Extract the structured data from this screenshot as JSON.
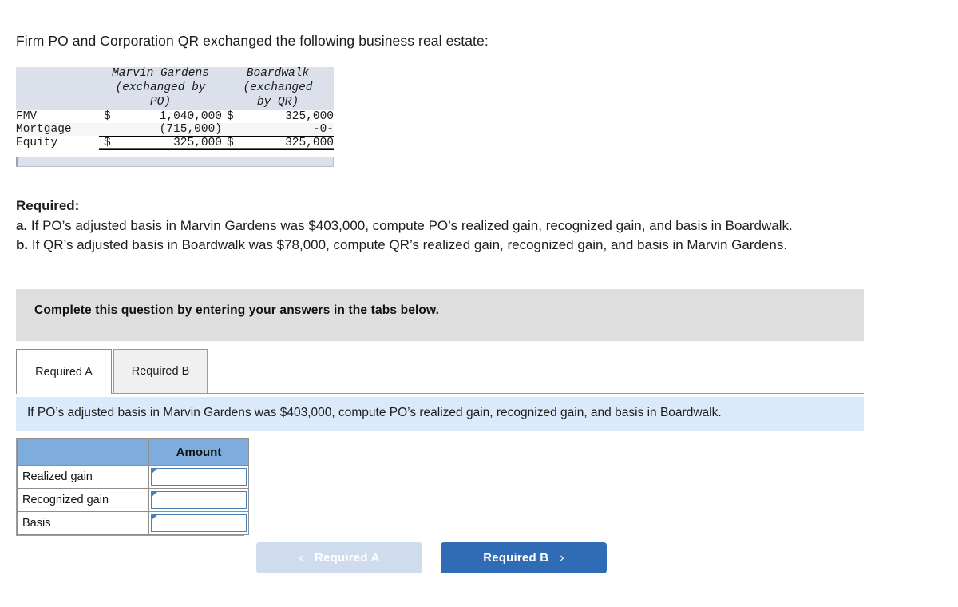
{
  "intro": {
    "text": "Firm PO and Corporation QR exchanged the following business real estate:"
  },
  "fact_table": {
    "headers": {
      "blank": "",
      "col1_line1": "Marvin Gardens",
      "col1_line2": "(exchanged by",
      "col1_line3": "PO)",
      "col2_line1": "Boardwalk",
      "col2_line2": "(exchanged",
      "col2_line3": "by QR)"
    },
    "rows": [
      {
        "label": "FMV",
        "mg_symbol": "$",
        "mg_value": "1,040,000",
        "bw_symbol": "$",
        "bw_value": "325,000"
      },
      {
        "label": "Mortgage",
        "mg_symbol": "",
        "mg_value": "(715,000)",
        "bw_symbol": "",
        "bw_value": "-0-"
      },
      {
        "label": "Equity",
        "mg_symbol": "$",
        "mg_value": "325,000",
        "bw_symbol": "$",
        "bw_value": "325,000"
      }
    ]
  },
  "required": {
    "title": "Required:",
    "item_a_marker": "a.",
    "item_a_text": "If PO’s adjusted basis in Marvin Gardens was $403,000, compute PO’s realized gain, recognized gain, and basis in Boardwalk.",
    "item_b_marker": "b.",
    "item_b_text": "If QR’s adjusted basis in Boardwalk was $78,000, compute QR’s realized gain, recognized gain, and basis in Marvin Gardens."
  },
  "gray_banner": {
    "text": "Complete this question by entering your answers in the tabs below."
  },
  "tabs": [
    {
      "label": "Required A",
      "active": true
    },
    {
      "label": "Required B",
      "active": false
    }
  ],
  "blue_bar": {
    "text": "If PO’s adjusted basis in Marvin Gardens was $403,000, compute PO’s realized gain, recognized gain, and basis in Boardwalk."
  },
  "answer_table": {
    "header_blank": "",
    "header_amount": "Amount",
    "rows": [
      {
        "label": "Realized gain",
        "value": "",
        "placeholder": ""
      },
      {
        "label": "Recognized gain",
        "value": "",
        "placeholder": ""
      },
      {
        "label": "Basis",
        "value": "",
        "placeholder": ""
      }
    ]
  },
  "nav": {
    "prev_label": "Required A",
    "prev_icon": "chevron-left-icon",
    "prev_chevron": "‹",
    "next_label": "Required B",
    "next_icon": "chevron-right-icon",
    "next_chevron": "›"
  },
  "colors": {
    "fact_header_bg": "#dbe0ea",
    "gray_banner_bg": "#dedede",
    "blue_bar_bg": "#dbeafb",
    "answer_header_bg": "#7dacdd",
    "input_border": "#4a80b8",
    "nav_next_bg": "#2f6cb5",
    "nav_prev_bg": "#cfdcee"
  }
}
